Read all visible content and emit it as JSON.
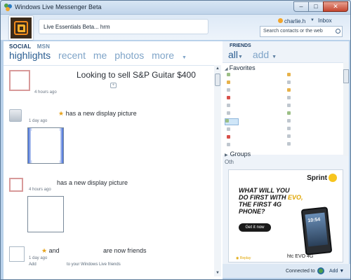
{
  "window": {
    "title": "Windows Live Messenger Beta"
  },
  "header": {
    "status_message": "Live Essentials Beta... hrm",
    "user_name": "charlie.h",
    "inbox": "Inbox",
    "search_placeholder": "Search contacts or the web"
  },
  "social": {
    "tabs": [
      "SOCIAL",
      "MSN"
    ],
    "nav": [
      "highlights",
      "recent",
      "me",
      "photos",
      "more"
    ],
    "feed": [
      {
        "title": "Looking to sell S&P Guitar $400",
        "time": "4 hours ago"
      },
      {
        "text": "has a new display picture",
        "time": "1 day ago"
      },
      {
        "text": "has a new display picture",
        "time": "4 hours ago"
      },
      {
        "text_and": "and",
        "text_end": "are now friends",
        "time": "1 day ago",
        "action": "Add",
        "action_text": "to your Windows Live friends"
      }
    ]
  },
  "friends": {
    "label": "FRIENDS",
    "nav": [
      "all",
      "add"
    ],
    "favorites": "Favorites",
    "groups": "Groups",
    "other": "Oth"
  },
  "ad": {
    "brand": "Sprint",
    "headline_1": "WHAT WILL YOU",
    "headline_2a": "DO FIRST WITH",
    "headline_2b": "EVO,",
    "headline_3": "THE FIRST 4G",
    "headline_4": "PHONE?",
    "cta": "Get it now",
    "phone_clock": "10:54",
    "phone_brand": "htc EVO 4G",
    "replay": "Replay"
  },
  "bottom": {
    "connected": "Connected to",
    "add": "Add"
  }
}
